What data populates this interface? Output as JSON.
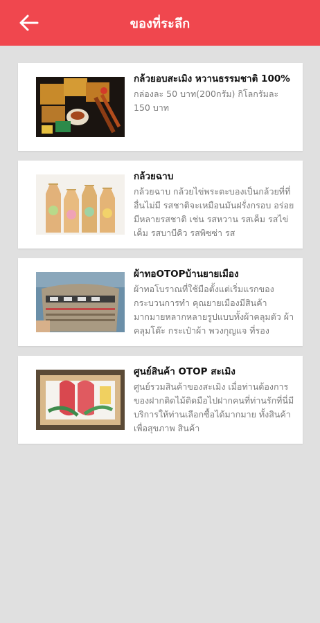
{
  "header": {
    "title": "ของที่ระลึก",
    "background": "#f0474e"
  },
  "items": [
    {
      "title": "กล้วยอบสะเมิง หวานธรรมชาติ 100%",
      "description": "กล่องละ 50 บาท(200กรัม) กิโลกรัมละ 150 บาท",
      "image_icon": "banana-box-photo"
    },
    {
      "title": "กล้วยฉาบ",
      "description": "กล้วยฉาบ กล้วยไข่พระตะบองเป็นกล้วยที่ที่อื่นไม่มี รสชาติจะเหมือนมันฝรั่งกรอบ อร่อย มีหลายรสชาติ เช่น รสหวาน รสเค็ม รสไข่เค็ม รสบาบีคิว รสพิซซ่า รส",
      "image_icon": "banana-chips-bags-photo"
    },
    {
      "title": "ผ้าทอOTOPบ้านยายเมือง",
      "description": "ผ้าทอโบราณที่ใช้มือตั้งแต่เริ่มแรกของกระบวนการทำ คุณยายเมืองมีสินค้ามากมายหลากหลายรูปแบบทั้งผ้าคลุมตัว ผ้าคลุมโต๊ะ กระเป๋าผ้า พวงกุญแจ ที่รอง",
      "image_icon": "woven-bag-photo"
    },
    {
      "title": "ศูนย์สินค้า OTOP สะเมิง",
      "description": "ศูนย์รวมสินค้าของสะเมิง เมื่อท่านต้องการของฝากติดไม้ติดมือไปฝากคนที่ท่านรักที่นี่มีบริการให้ท่านเลือกซื้อได้มากมาย ทั้งสินค้าเพื่อสุขภาพ สินค้า",
      "image_icon": "otop-product-box-photo"
    }
  ]
}
